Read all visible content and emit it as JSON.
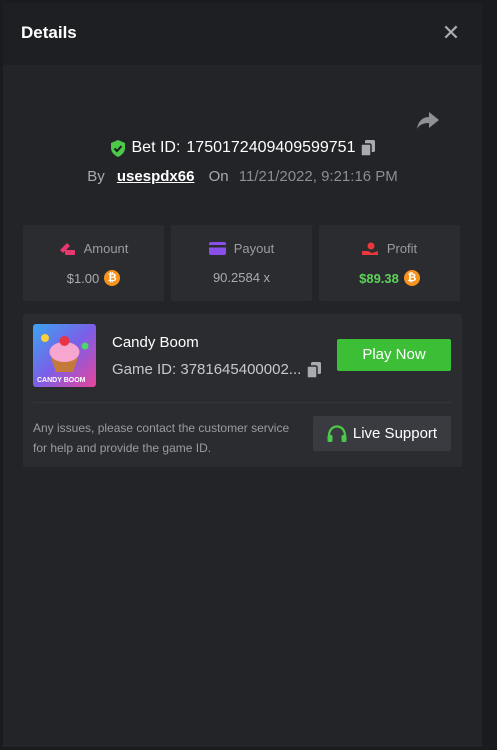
{
  "header": {
    "title": "Details",
    "close_icon": "close-icon"
  },
  "bet": {
    "label": "Bet ID:",
    "id": "1750172409409599751",
    "by_label": "By",
    "user": "usespdx66",
    "on_label": "On",
    "date": "11/21/2022, 9:21:16 PM"
  },
  "stats": {
    "amount": {
      "label": "Amount",
      "value": "$1.00",
      "icon": "amount-icon"
    },
    "payout": {
      "label": "Payout",
      "value": "90.2584 x",
      "icon": "card-icon"
    },
    "profit": {
      "label": "Profit",
      "value": "$89.38",
      "icon": "profit-icon"
    }
  },
  "game": {
    "name": "Candy Boom",
    "id_text": "Game ID: 3781645400002...",
    "thumb_text": "CANDY BOOM",
    "play_label": "Play Now",
    "issue_text": "Any issues, please contact the customer service for help and provide the game ID.",
    "support_label": "Live Support"
  },
  "colors": {
    "accent_green": "#3cbf37",
    "profit_green": "#5fd25a",
    "btc": "#f7931a",
    "verify": "#4cc948"
  }
}
